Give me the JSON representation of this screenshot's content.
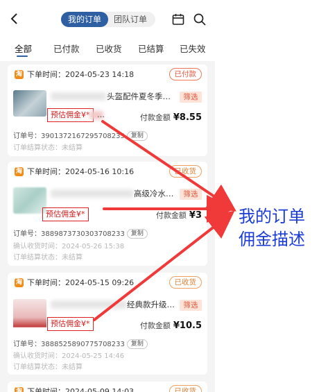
{
  "header": {
    "tabs": [
      {
        "label": "我的订单",
        "active": true
      },
      {
        "label": "团队订单",
        "active": false
      }
    ]
  },
  "filters": [
    "全部",
    "已付款",
    "已收货",
    "已结算",
    "已失效"
  ],
  "orders": [
    {
      "time": "下单时间：2024-05-23 14:18",
      "status": "已付款",
      "title": "头盔配件夏冬季…",
      "filter_label": "筛选",
      "commission": "预估佣金¥*",
      "pay_label": "付款金额",
      "amount": "¥8.55",
      "order_no": "订单号：3901372167295708233",
      "copy_label": "复制",
      "confirm_time": "",
      "settle_status": "订单结算状态：未结算"
    },
    {
      "time": "下单时间：2024-05-16 10:16",
      "status": "已收货",
      "title": "高级冷水…",
      "filter_label": "筛选",
      "commission": "预估佣金¥*",
      "pay_label": "付款金额",
      "amount": "¥3",
      "order_no": "订单号：3889873730303708233",
      "copy_label": "复制",
      "confirm_time": "确认收货时间：2024-05-26 15:38",
      "settle_status": "订单结算状态：未结算"
    },
    {
      "time": "下单时间：2024-05-15 09:26",
      "status": "已收货",
      "title": "经典款升级…",
      "filter_label": "筛选",
      "commission": "预估佣金¥*",
      "pay_label": "付款金额",
      "amount": "¥10.5",
      "order_no": "订单号：3888525890775708233",
      "copy_label": "复制",
      "confirm_time": "确认收货时间：2024-05-25 14:46",
      "settle_status": "订单结算状态：未结算"
    },
    {
      "time": "下单时间：2024-05-09 14:03",
      "status": "已收货"
    }
  ],
  "annotation": {
    "line1": "我的订单",
    "line2": "佣金描述"
  },
  "colors": {
    "primary": "#2e5fa3",
    "annotation": "#1c3cd6",
    "arrow": "#f03a3a",
    "commission_border": "#e02020"
  }
}
